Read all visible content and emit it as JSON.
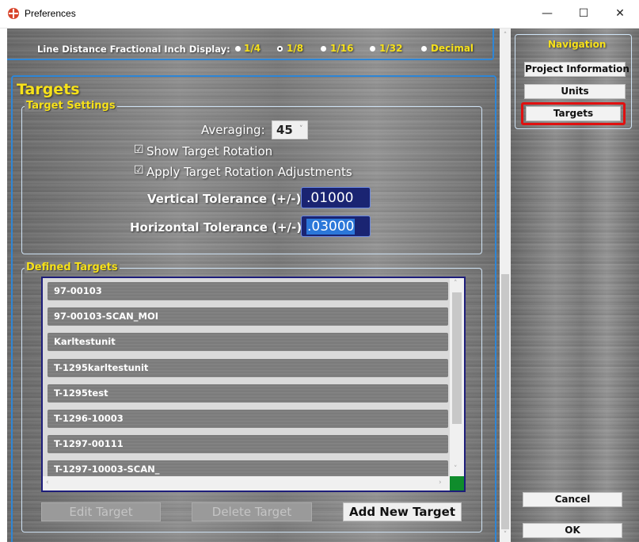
{
  "window": {
    "title": "Preferences",
    "minimize_glyph": "—",
    "maximize_glyph": "☐",
    "close_glyph": "✕"
  },
  "line_distance": {
    "label": "Line Distance Fractional Inch Display:",
    "options": [
      "1/4",
      "1/8",
      "1/16",
      "1/32",
      "Decimal"
    ],
    "selected": "1/8"
  },
  "targets_section": {
    "heading": "Targets",
    "settings_group": "Target Settings",
    "averaging_label": "Averaging:",
    "averaging_value": "45",
    "show_rotation_label": "Show Target Rotation",
    "show_rotation_checked": true,
    "apply_rotation_label": "Apply Target Rotation Adjustments",
    "apply_rotation_checked": true,
    "vertical_tol_label": "Vertical Tolerance (+/-):",
    "vertical_tol_value": ".01000",
    "horizontal_tol_label": "Horizontal Tolerance (+/-):",
    "horizontal_tol_value": ".03000"
  },
  "defined_targets": {
    "group_label": "Defined Targets",
    "items": [
      "97-00103",
      "97-00103-SCAN_MOI",
      "Karltestunit",
      "T-1295karltestunit",
      "T-1295test",
      "T-1296-10003",
      "T-1297-00111",
      "T-1297-10003-SCAN_"
    ],
    "edit_button": "Edit Target",
    "delete_button": "Delete Target",
    "add_button": "Add New Target"
  },
  "navigation": {
    "title": "Navigation",
    "items": [
      "Project Information",
      "Units",
      "Targets"
    ],
    "active": "Targets",
    "highlight_color": "#e01010"
  },
  "footer": {
    "cancel": "Cancel",
    "ok": "OK"
  },
  "colors": {
    "accent_yellow": "#f7e11a",
    "frame_blue": "#2e86d6",
    "field_navy": "#1a2472"
  }
}
